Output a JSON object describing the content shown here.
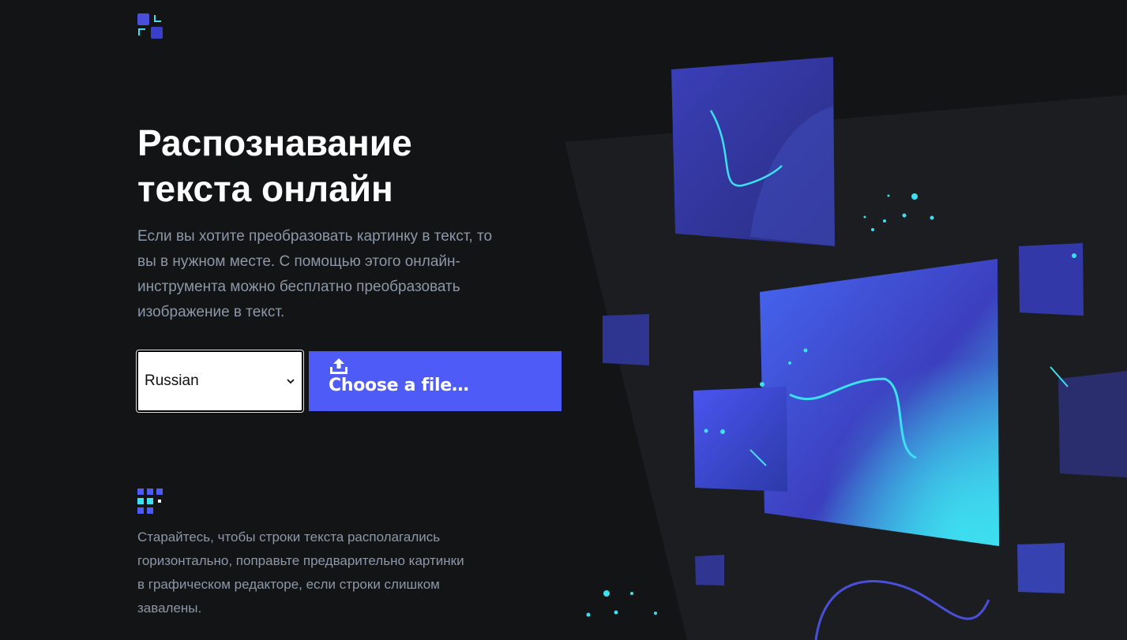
{
  "brand": {
    "logo_icon": "logo-icon"
  },
  "hero": {
    "title_line1": "Распознавание",
    "title_line2": "текста онлайн",
    "description": "Если вы хотите преобразовать картинку в текст, то вы в нужном месте. С помощью этого онлайн-инструмента можно бесплатно преобразовать изображение в текст."
  },
  "controls": {
    "language_selected": "Russian",
    "file_button_label": "Choose a file…",
    "upload_icon": "upload-icon"
  },
  "tip": {
    "icon": "grid-dots-icon",
    "text": "Старайтесь, чтобы строки текста располагались горизонтально, поправьте предварительно картинки в графическом редакторе, если строки слишком завалены."
  },
  "colors": {
    "background": "#131416",
    "accent": "#4f5bf6",
    "text_muted": "#8c97a8",
    "cyan": "#3de0f0"
  }
}
